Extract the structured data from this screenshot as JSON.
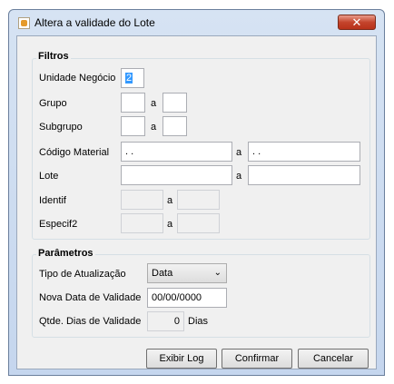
{
  "window": {
    "title": "Altera a validade do Lote",
    "close_glyph": "✕",
    "app_icon": "app-icon"
  },
  "filtros": {
    "title": "Filtros",
    "unidade_label": "Unidade Negócio",
    "unidade_value": "2",
    "grupo_label": "Grupo",
    "subgrupo_label": "Subgrupo",
    "codigo_label": "Código Material",
    "codigo_from": " .  .",
    "codigo_to": " .  .",
    "lote_label": "Lote",
    "identif_label": "Identif",
    "especif_label": "Especif2",
    "range_sep": "a"
  },
  "parametros": {
    "title": "Parâmetros",
    "tipo_label": "Tipo de Atualização",
    "tipo_value": "Data",
    "nova_label": "Nova Data de Validade",
    "nova_value": "00/00/0000",
    "qtde_label": "Qtde. Dias de Validade",
    "qtde_value": "0",
    "dias_unit": "Dias"
  },
  "buttons": {
    "exibir": "Exibir Log",
    "confirmar": "Confirmar",
    "cancelar": "Cancelar"
  }
}
